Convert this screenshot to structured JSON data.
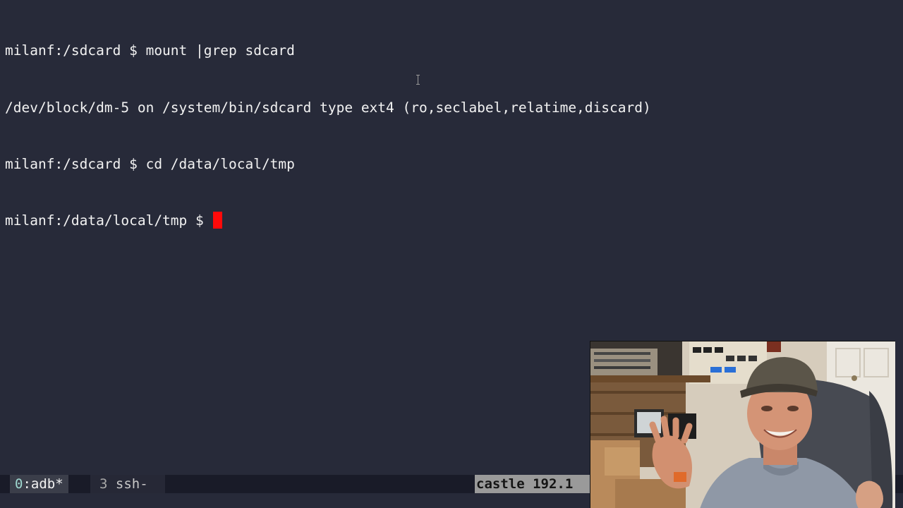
{
  "terminal": {
    "lines": [
      "milanf:/sdcard $ mount |grep sdcard",
      "/dev/block/dm-5 on /system/bin/sdcard type ext4 (ro,seclabel,relatime,discard)",
      "milanf:/sdcard $ cd /data/local/tmp",
      "milanf:/data/local/tmp $ "
    ],
    "cursor_color": "#ff0a0a",
    "background": "#272a39",
    "foreground": "#f2f2f2"
  },
  "statusbar": {
    "windows": [
      {
        "index": "0",
        "sep": ":",
        "name": "adb*",
        "active": true
      },
      {
        "index": "3",
        "sep": " ",
        "name": "ssh-",
        "active": false
      }
    ],
    "host": "castle 192.1"
  },
  "webcam": {
    "icon": "webcam-presenter-image"
  }
}
